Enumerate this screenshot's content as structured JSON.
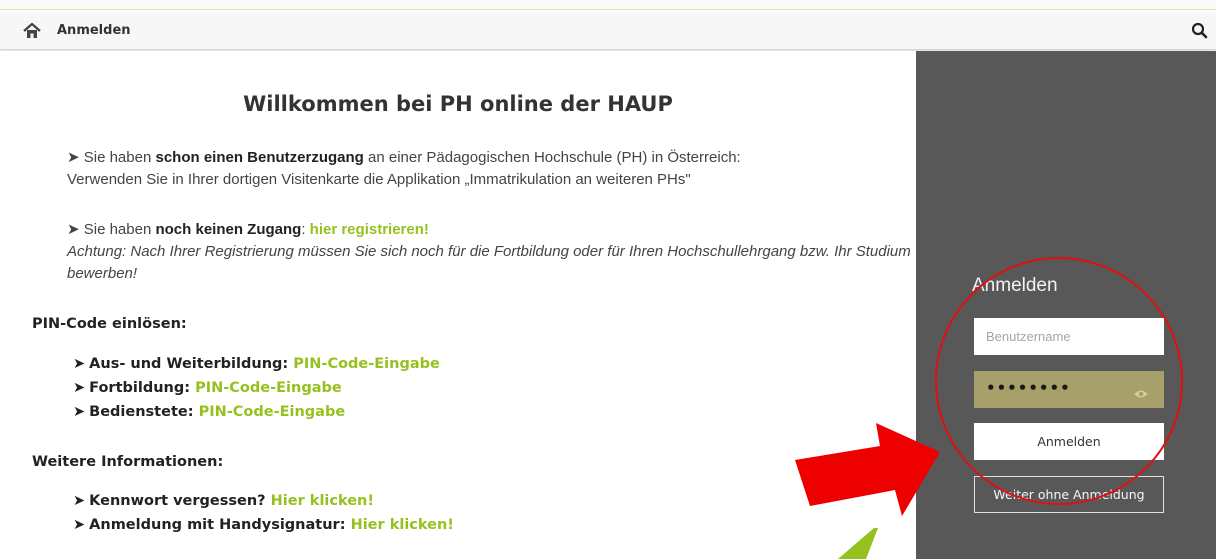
{
  "topbar": {
    "home_icon": "home-icon",
    "title": "Anmelden",
    "search_icon": "search-icon"
  },
  "main": {
    "heading": "Willkommen bei PH online der HAUP",
    "para1": {
      "arrow": "➤",
      "t1": " Sie haben ",
      "b1": "schon einen Benutzerzugang",
      "t2": " an einer Pädagogischen Hochschule (PH) in Österreich:",
      "t3": "Verwenden Sie in Ihrer dortigen Visitenkarte die Applikation „Immatrikulation an weiteren PHs\""
    },
    "para2": {
      "arrow": "➤",
      "t1": " Sie haben ",
      "b1": "noch keinen Zugang",
      "t2": ": ",
      "link": "hier registrieren!",
      "note": "Achtung: Nach Ihrer Registrierung müssen Sie sich noch für die Fortbildung oder für Ihren Hochschullehrgang bzw. Ihr Studium bewerben!"
    },
    "pin_section": {
      "heading": "PIN-Code einlösen:",
      "items": [
        {
          "label": "Aus- und Weiterbildung",
          "link": "PIN-Code-Eingabe"
        },
        {
          "label": "Fortbildung",
          "link": "PIN-Code-Eingabe"
        },
        {
          "label": "Bedienstete",
          "link": "PIN-Code-Eingabe"
        }
      ]
    },
    "info_section": {
      "heading": "Weitere Informationen:",
      "items": [
        {
          "label": "Kennwort vergessen?",
          "link": "Hier klicken!"
        },
        {
          "label": "Anmeldung mit Handysignatur:",
          "link": "Hier klicken!"
        }
      ]
    }
  },
  "login": {
    "title": "Anmelden",
    "username_placeholder": "Benutzername",
    "password_mask": "••••••••",
    "eye_icon": "eye-icon",
    "submit_label": "Anmelden",
    "guest_label": "Weiter ohne Anmeldung"
  },
  "colors": {
    "accent_green": "#95c11f",
    "sidebar_bg": "#585858",
    "password_bg": "#a8a06b",
    "annotation_red": "#e01010"
  }
}
